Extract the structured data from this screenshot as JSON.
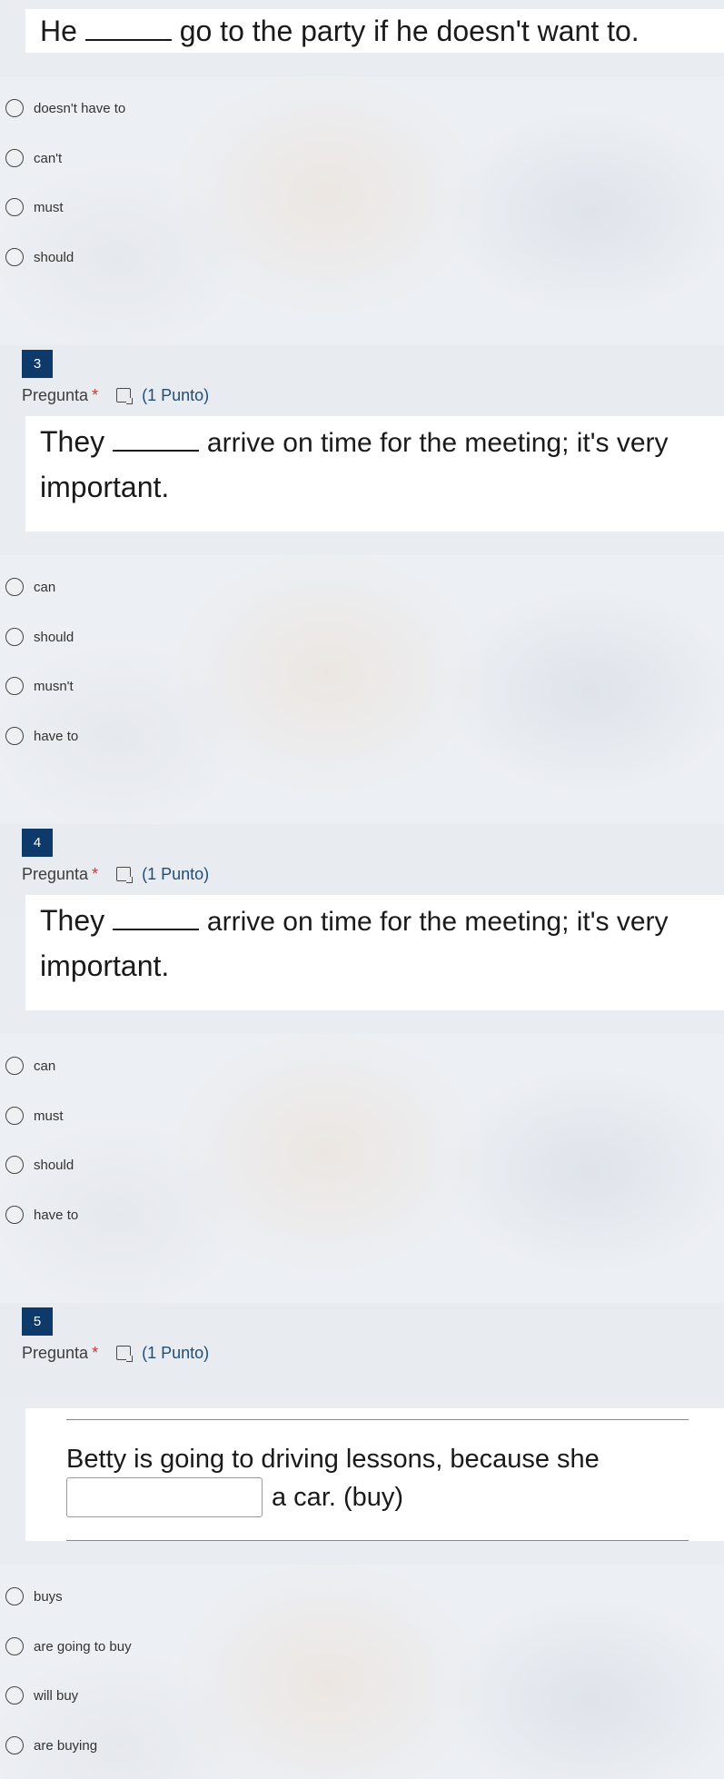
{
  "q2": {
    "text_before": "He",
    "text_after": "go to the party if he doesn't want to.",
    "options": [
      "doesn't have to",
      "can't",
      "must",
      "should"
    ]
  },
  "q3": {
    "number": "3",
    "label": "Pregunta",
    "required": "*",
    "points": "(1 Punto)",
    "line1_before": "They",
    "line1_after": "arrive on time for the meeting; it's very",
    "line2": "important.",
    "options": [
      "can",
      "should",
      "musn't",
      "have to"
    ]
  },
  "q4": {
    "number": "4",
    "label": "Pregunta",
    "required": "*",
    "points": "(1 Punto)",
    "line1_before": "They",
    "line1_after": "arrive on time for the meeting; it's very",
    "line2": "important.",
    "options": [
      "can",
      "must",
      "should",
      "have to"
    ]
  },
  "q5": {
    "number": "5",
    "label": "Pregunta",
    "required": "*",
    "points": "(1 Punto)",
    "line1": "Betty is going to driving lessons, because she",
    "after_box": "a car. (buy)",
    "options": [
      "buys",
      "are going to buy",
      "will buy",
      "are buying"
    ]
  },
  "icons": {
    "reader": "immersive-reader-icon",
    "radio": "radio-button"
  }
}
